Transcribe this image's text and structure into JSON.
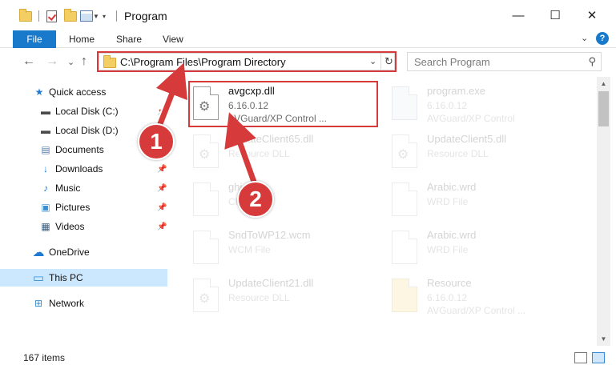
{
  "window": {
    "title": "Program",
    "minimize": "—",
    "maximize": "☐",
    "close": "✕"
  },
  "ribbon": {
    "tabs": [
      "File",
      "Home",
      "Share",
      "View"
    ],
    "collapse": "⌄",
    "help": "?"
  },
  "nav": {
    "back": "←",
    "forward": "→",
    "recent": "⌄",
    "up": "↑",
    "address": "C:\\Program Files\\Program Directory",
    "address_dropdown": "⌄",
    "refresh": "↻",
    "search_placeholder": "Search Program",
    "search_icon": "⚲"
  },
  "sidebar": {
    "items": [
      {
        "label": "Quick access",
        "icon": "star-icon",
        "glyph": "★",
        "color": "#1e7bd4"
      },
      {
        "label": "Local Disk (C:)",
        "icon": "drive-icon",
        "glyph": "▬",
        "color": "#4a4a4a",
        "pinned": true
      },
      {
        "label": "Local Disk (D:)",
        "icon": "drive-icon",
        "glyph": "▬",
        "color": "#4a4a4a",
        "pinned": true
      },
      {
        "label": "Documents",
        "icon": "documents-icon",
        "glyph": "▤",
        "color": "#5a7fa8",
        "pinned": true
      },
      {
        "label": "Downloads",
        "icon": "downloads-icon",
        "glyph": "↓",
        "color": "#1e7bd4",
        "pinned": true
      },
      {
        "label": "Music",
        "icon": "music-icon",
        "glyph": "♪",
        "color": "#1e7bd4",
        "pinned": true
      },
      {
        "label": "Pictures",
        "icon": "pictures-icon",
        "glyph": "▣",
        "color": "#3a8fd0",
        "pinned": true
      },
      {
        "label": "Videos",
        "icon": "videos-icon",
        "glyph": "▦",
        "color": "#3c5f80",
        "pinned": true
      },
      {
        "label": "OneDrive",
        "icon": "onedrive-icon",
        "glyph": "☁",
        "color": "#1e7bd4"
      },
      {
        "label": "This PC",
        "icon": "computer-icon",
        "glyph": "▭",
        "color": "#3a8fd0",
        "selected": true
      },
      {
        "label": "Network",
        "icon": "network-icon",
        "glyph": "⊞",
        "color": "#3a8fd0"
      }
    ],
    "pin_glyph": "📌"
  },
  "files": [
    {
      "name": "avgcxp.dll",
      "line2": "6.16.0.12",
      "line3": "AVGuard/XP Control ...",
      "type": "dll",
      "highlight": true
    },
    {
      "name": "program.exe",
      "line2": "6.16.0.12",
      "line3": "AVGuard/XP Control",
      "type": "exe"
    },
    {
      "name": "UpdateClient65.dll",
      "line2": "Resource DLL",
      "line3": "",
      "type": "dll"
    },
    {
      "name": "UpdateClient5.dll",
      "line2": "Resource DLL",
      "line3": "",
      "type": "dll"
    },
    {
      "name": "ghi...",
      "line2": "CHI...",
      "line3": "",
      "type": "blank"
    },
    {
      "name": "Arabic.wrd",
      "line2": "WRD File",
      "line3": "",
      "type": "blank"
    },
    {
      "name": "SndToWP12.wcm",
      "line2": "WCM File",
      "line3": "",
      "type": "blank"
    },
    {
      "name": "Arabic.wrd",
      "line2": "WRD File",
      "line3": "",
      "type": "blank"
    },
    {
      "name": "UpdateClient21.dll",
      "line2": "Resource DLL",
      "line3": "",
      "type": "dll"
    },
    {
      "name": "Resource",
      "line2": "6.16.0.12",
      "line3": "AVGuard/XP Control ...",
      "type": "res"
    }
  ],
  "status": {
    "items_count": "167 items"
  },
  "callouts": {
    "one": "1",
    "two": "2",
    "color": "#d63a3a"
  }
}
